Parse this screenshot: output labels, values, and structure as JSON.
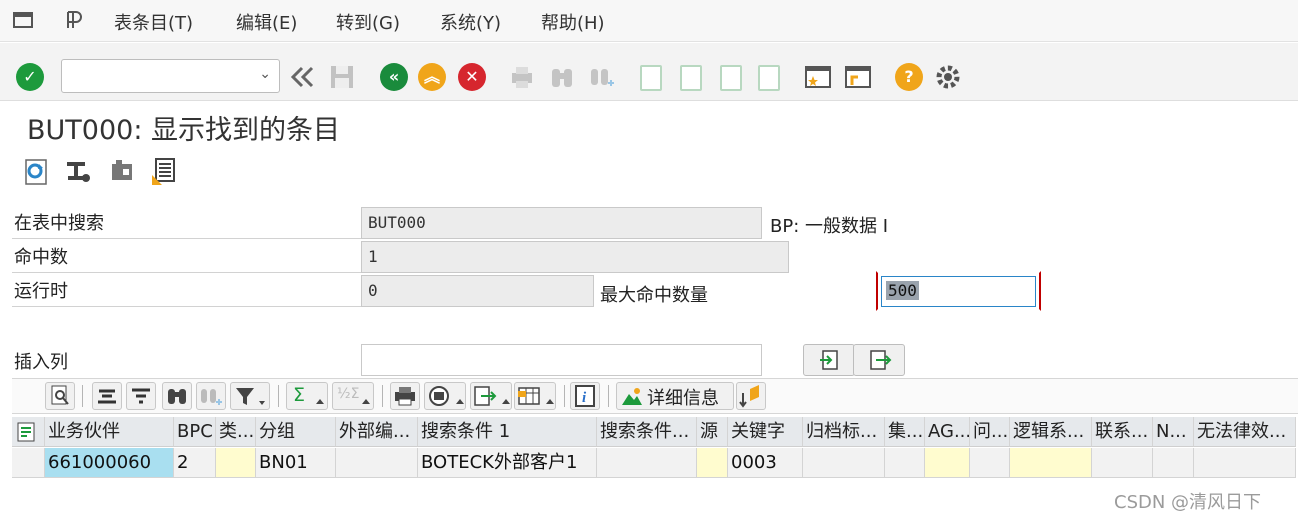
{
  "menu": {
    "items": [
      "表条目(T)",
      "编辑(E)",
      "转到(G)",
      "系统(Y)",
      "帮助(H)"
    ]
  },
  "toolbar": {
    "command_field_value": "",
    "icons": [
      "enter-icon",
      "back-arrows-icon",
      "save-icon",
      "back-icon",
      "exit-icon",
      "cancel-icon",
      "print-icon",
      "find-icon",
      "find-next-icon",
      "first-page-icon",
      "previous-page-icon",
      "next-page-icon",
      "last-page-icon",
      "create-session-icon",
      "shortcut-icon",
      "help-icon",
      "settings-icon"
    ]
  },
  "title": "BUT000: 显示找到的条目",
  "form": {
    "search_table_label": "在表中搜索",
    "search_table_value": "BUT000",
    "search_table_desc": "BP: 一般数据 I",
    "hits_label": "命中数",
    "hits_value": "1",
    "runtime_label": "运行时",
    "runtime_value": "0",
    "max_hits_label": "最大命中数量",
    "max_hits_value": "500",
    "insert_col_label": "插入列",
    "insert_col_value": ""
  },
  "alv_toolbar": {
    "detail_label": "详细信息"
  },
  "grid": {
    "columns": [
      "业务伙伴",
      "BPC",
      "类...",
      "分组",
      "外部编...",
      "搜索条件 1",
      "搜索条件...",
      "源",
      "关键字",
      "归档标...",
      "集...",
      "AG...",
      "问...",
      "逻辑系...",
      "联系...",
      "N...",
      "无法律效..."
    ],
    "rows": [
      [
        "661000060",
        "2",
        "",
        "BN01",
        "",
        "BOTECK外部客户1",
        "",
        "",
        "0003",
        "",
        "",
        "",
        "",
        "",
        "",
        "",
        ""
      ]
    ]
  },
  "watermark": "CSDN @清风日下",
  "colors": {
    "ok_green": "#1d9a3c",
    "back_green": "#1a8b3c",
    "exit_orange": "#f0a51a",
    "cancel_red": "#d6262e",
    "help_orange": "#f0a51a",
    "key_col_blue": "#a9dff0",
    "editable_yellow": "#fffccf"
  }
}
